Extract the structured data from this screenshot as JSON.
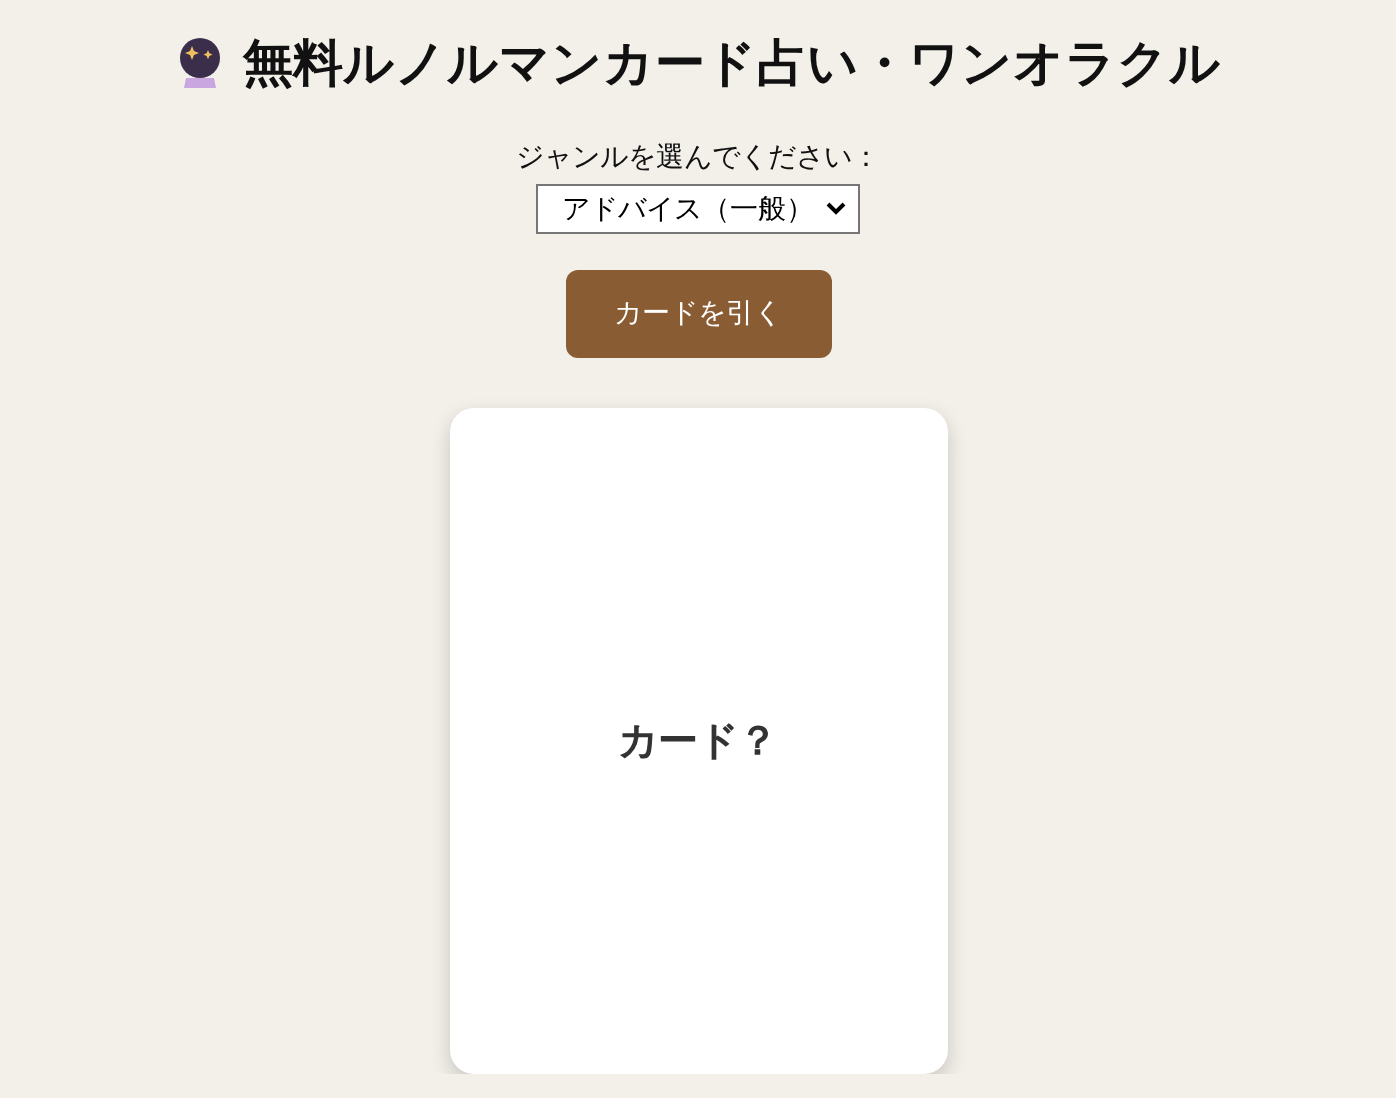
{
  "title": "無料ルノルマンカード占い・ワンオラクル",
  "genre": {
    "label": "ジャンルを選んでください：",
    "value": "アドバイス（一般）"
  },
  "draw_button": "カードを引く",
  "card": {
    "text": "カード？"
  }
}
